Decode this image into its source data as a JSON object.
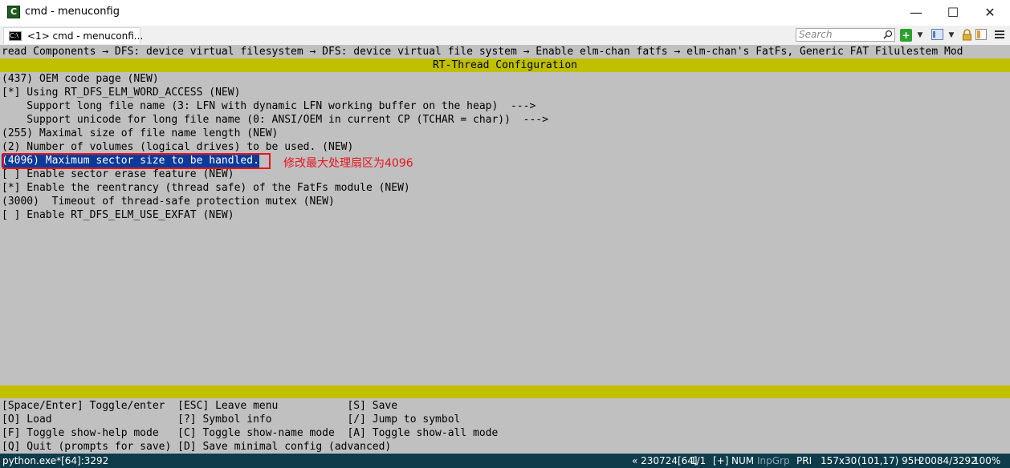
{
  "window": {
    "title": "cmd - menuconfig",
    "icon_glyph": "C",
    "controls": {
      "minimize": "—",
      "maximize": "☐",
      "close": "✕"
    }
  },
  "tabbar": {
    "tab_label": "<1> cmd - menuconfi...",
    "search_placeholder": "Search",
    "icons": [
      "search-icon",
      "new-console-icon",
      "dropdown-icon",
      "view-icon",
      "dropdown-icon",
      "lock-icon",
      "panel-icon",
      "menu-icon"
    ]
  },
  "terminal": {
    "breadcrumb": "read Components → DFS: device virtual filesystem → DFS: device virtual file system → Enable elm-chan fatfs → elm-chan's FatFs, Generic FAT Filulestem Mod",
    "header": "RT-Thread Configuration",
    "menu_items": [
      "(437) OEM code page (NEW)",
      "[*] Using RT_DFS_ELM_WORD_ACCESS (NEW)",
      "    Support long file name (3: LFN with dynamic LFN working buffer on the heap)  --->",
      "    Support unicode for long file name (0: ANSI/OEM in current CP (TCHAR = char))  --->",
      "(255) Maximal size of file name length (NEW)",
      "(2) Number of volumes (logical drives) to be used. (NEW)",
      "(4096) Maximum sector size to be handled.",
      "[ ] Enable sector erase feature (NEW)",
      "[*] Enable the reentrancy (thread safe) of the FatFs module (NEW)",
      "(3000)  Timeout of thread-safe protection mutex (NEW)",
      "[ ] Enable RT_DFS_ELM_USE_EXFAT (NEW)"
    ],
    "selected_index": 6,
    "annotation": "修改最大处理扇区为4096",
    "help_lines": [
      "[Space/Enter] Toggle/enter  [ESC] Leave menu           [S] Save",
      "[O] Load                    [?] Symbol info            [/] Jump to symbol",
      "[F] Toggle show-help mode   [C] Toggle show-name mode  [A] Toggle show-all mode",
      "[Q] Quit (prompts for save) [D] Save minimal config (advanced)"
    ]
  },
  "statusbar": {
    "process": "python.exe*[64]:3292",
    "build": "« 230724[64]",
    "page": "1/1",
    "plus": "[+]",
    "num": "NUM",
    "inpgrp": "InpGrp",
    "pri": "PRI",
    "size": "157x30",
    "cursor": "(101,17) 95H",
    "pid": "20084/3292",
    "zoom": "100%"
  },
  "colors": {
    "terminal_bg": "#c0c0c0",
    "bar_yellow": "#c0c000",
    "selection": "#0a3a9a",
    "annotation_red": "#e8141e",
    "status_bg": "#0e3c4a"
  }
}
